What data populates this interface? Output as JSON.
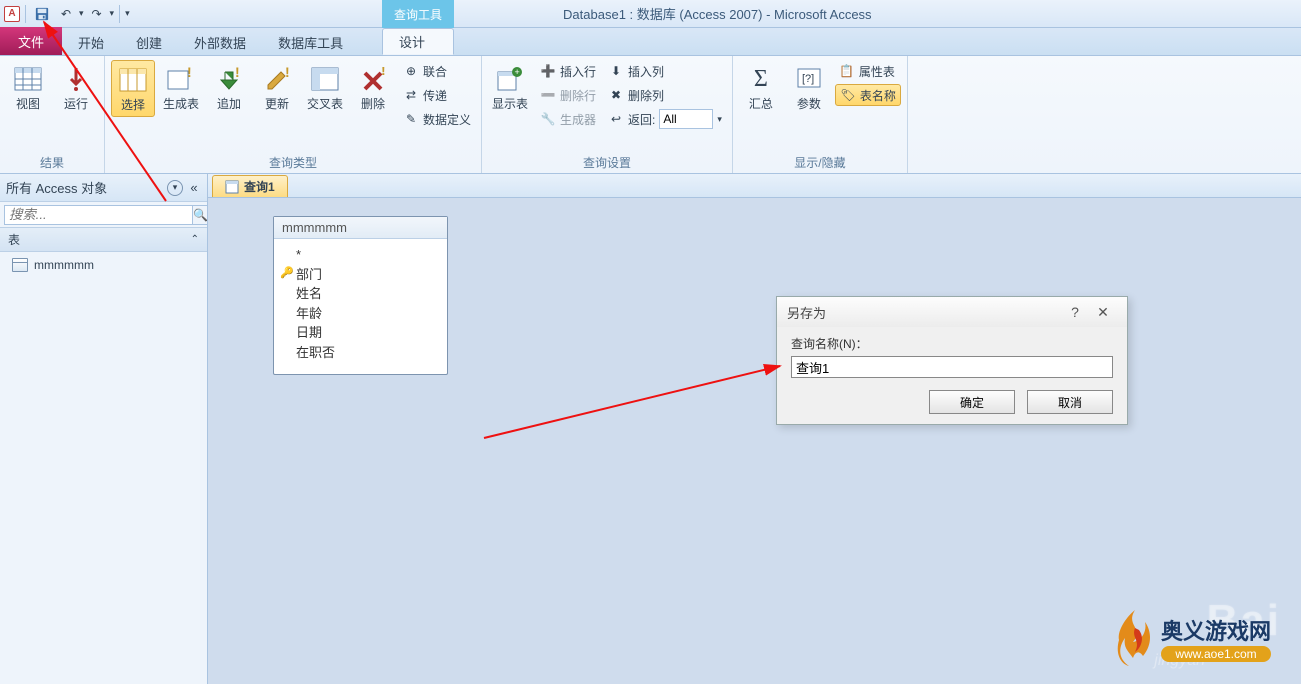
{
  "title": "Database1 : 数据库 (Access 2007) - Microsoft Access",
  "qat": {
    "app_letter": "A",
    "undo": "↶",
    "redo": "↷"
  },
  "context_tab": "查询工具",
  "tabs": {
    "file": "文件",
    "home": "开始",
    "create": "创建",
    "external": "外部数据",
    "dbtools": "数据库工具",
    "design": "设计"
  },
  "ribbon": {
    "results": {
      "label": "结果",
      "view": "视图",
      "run": "运行"
    },
    "querytype": {
      "label": "查询类型",
      "select": "选择",
      "maketable": "生成表",
      "append": "追加",
      "update": "更新",
      "crosstab": "交叉表",
      "delete": "删除",
      "union": "联合",
      "passthrough": "传递",
      "datadef": "数据定义"
    },
    "setup": {
      "label": "查询设置",
      "showtable": "显示表",
      "insertrow": "插入行",
      "deleterow": "删除行",
      "builder": "生成器",
      "insertcol": "插入列",
      "deletecol": "删除列",
      "return": "返回:",
      "return_val": "All"
    },
    "showhide": {
      "label": "显示/隐藏",
      "totals": "汇总",
      "params": "参数",
      "propsheet": "属性表",
      "tablenames": "表名称"
    }
  },
  "nav": {
    "header": "所有 Access 对象",
    "search_placeholder": "搜索...",
    "group_tables": "表",
    "items": {
      "0": {
        "label": "mmmmmm"
      }
    }
  },
  "doc": {
    "tab": "查询1",
    "table": {
      "title": "mmmmmm",
      "fields": [
        "*",
        "部门",
        "姓名",
        "年龄",
        "日期",
        "在职否"
      ],
      "key_index": 1
    }
  },
  "dialog": {
    "title": "另存为",
    "label": "查询名称(N)：",
    "value": "查询1",
    "ok": "确定",
    "cancel": "取消"
  },
  "watermark": {
    "brand": "Bai",
    "sub": "jingyan"
  },
  "site": {
    "name": "奥义游戏网",
    "url": "www.aoe1.com"
  }
}
